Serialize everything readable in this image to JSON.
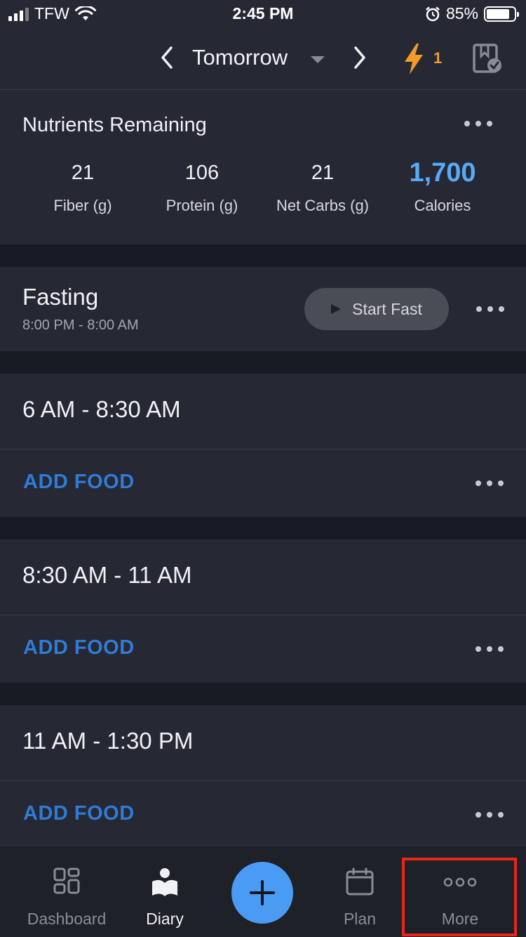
{
  "status_bar": {
    "carrier": "TFW",
    "time": "2:45 PM",
    "battery": "85%",
    "battery_level": 0.85
  },
  "header": {
    "date_label": "Tomorrow",
    "bolt_count": "1",
    "accent_color": "#f39a2b"
  },
  "nutrients": {
    "heading": "Nutrients Remaining",
    "items": [
      {
        "value": "21",
        "label": "Fiber (g)"
      },
      {
        "value": "106",
        "label": "Protein (g)"
      },
      {
        "value": "21",
        "label": "Net Carbs (g)"
      },
      {
        "value": "1,700",
        "label": "Calories"
      }
    ],
    "calories_color": "#5aa9f7"
  },
  "fasting": {
    "title": "Fasting",
    "time_range": "8:00 PM - 8:00 AM",
    "button_label": "Start Fast"
  },
  "meals": [
    {
      "title": "6 AM - 8:30 AM",
      "add_label": "ADD FOOD"
    },
    {
      "title": "8:30 AM - 11 AM",
      "add_label": "ADD FOOD"
    },
    {
      "title": "11 AM - 1:30 PM",
      "add_label": "ADD FOOD"
    }
  ],
  "tabs": [
    {
      "label": "Dashboard",
      "icon": "dashboard-icon"
    },
    {
      "label": "Diary",
      "icon": "diary-icon",
      "active": true
    },
    {
      "label": "",
      "icon": "plus-icon"
    },
    {
      "label": "Plan",
      "icon": "calendar-icon"
    },
    {
      "label": "More",
      "icon": "more-icon",
      "highlighted": true
    }
  ],
  "highlight_color": "#e8271b"
}
